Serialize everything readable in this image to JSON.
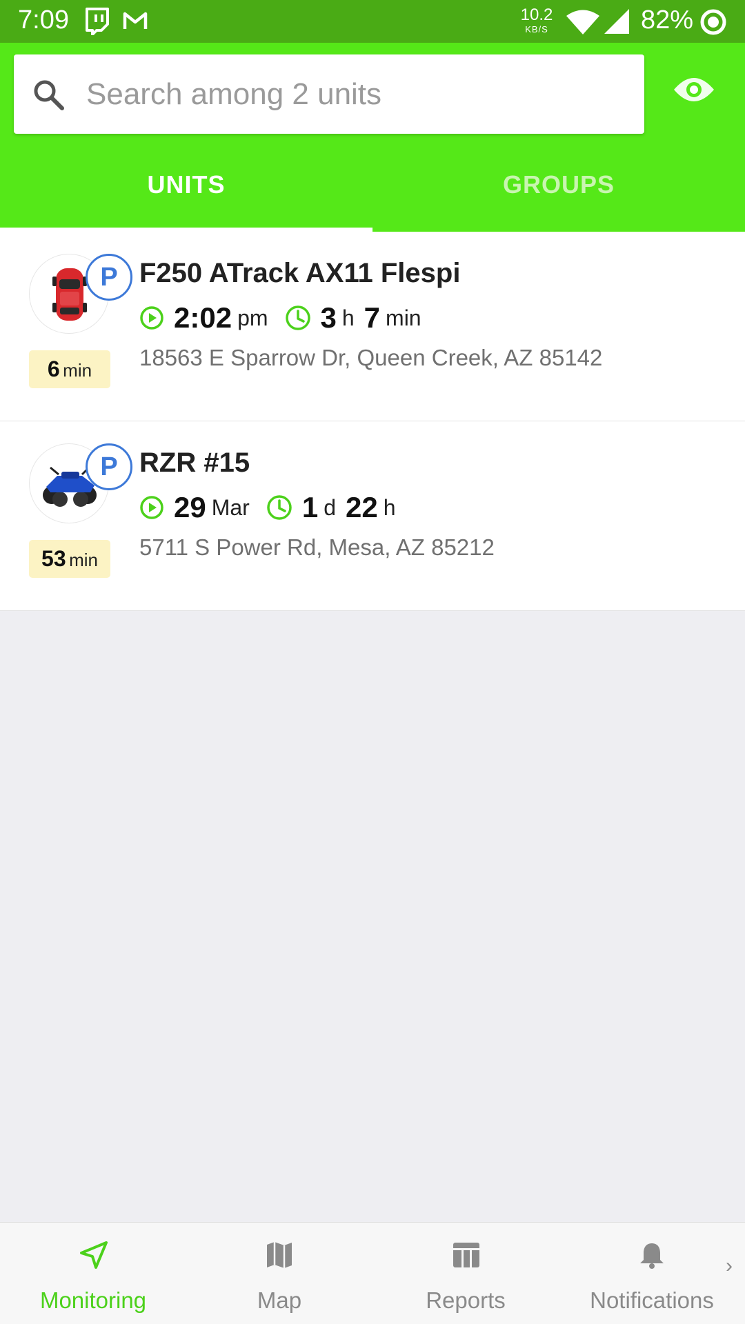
{
  "status_bar": {
    "time": "7:09",
    "net_speed": "10.2",
    "net_speed_unit": "KB/S",
    "battery": "82%",
    "icons": [
      "twitch-icon",
      "gmail-icon",
      "wifi-icon",
      "signal-icon",
      "battery-ring-icon"
    ]
  },
  "header": {
    "search_placeholder": "Search among 2 units",
    "tabs": [
      {
        "label": "UNITS",
        "active": true
      },
      {
        "label": "GROUPS",
        "active": false
      }
    ],
    "accent_color": "#55e818",
    "status_bar_color": "#4aab15"
  },
  "units": [
    {
      "name": "F250 ATrack AX11 Flespi",
      "status": "P",
      "duration_value": "6",
      "duration_unit": "min",
      "time_value": "2:02",
      "time_unit": "pm",
      "elapsed_a_value": "3",
      "elapsed_a_unit": "h",
      "elapsed_b_value": "7",
      "elapsed_b_unit": "min",
      "address": "18563 E Sparrow Dr, Queen Creek, AZ 85142",
      "icon": "red-car-icon"
    },
    {
      "name": "RZR #15",
      "status": "P",
      "duration_value": "53",
      "duration_unit": "min",
      "time_value": "29",
      "time_unit": "Mar",
      "elapsed_a_value": "1",
      "elapsed_a_unit": "d",
      "elapsed_b_value": "22",
      "elapsed_b_unit": "h",
      "address": "5711 S Power Rd, Mesa, AZ 85212",
      "icon": "atv-icon"
    }
  ],
  "bottom_nav": {
    "items": [
      {
        "label": "Monitoring",
        "icon": "navigation-arrow-icon",
        "active": true
      },
      {
        "label": "Map",
        "icon": "map-icon",
        "active": false
      },
      {
        "label": "Reports",
        "icon": "reports-table-icon",
        "active": false
      },
      {
        "label": "Notifications",
        "icon": "bell-icon",
        "active": false
      }
    ],
    "active_color": "#4cd11b",
    "more": "›"
  }
}
